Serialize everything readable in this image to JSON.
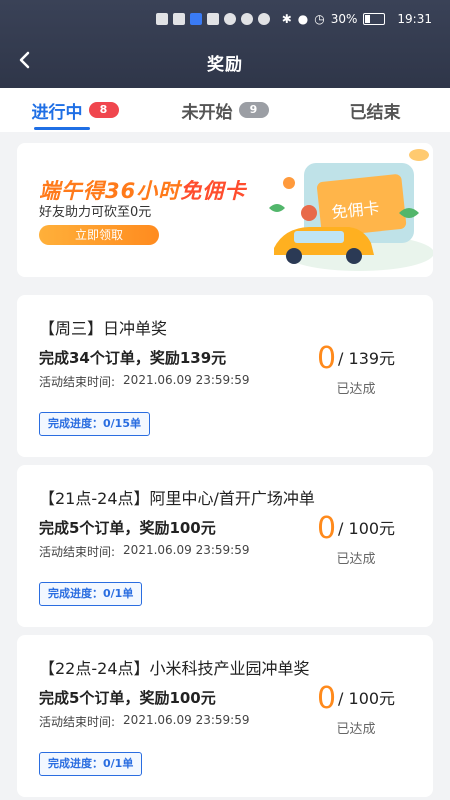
{
  "status_bar": {
    "battery": "30%",
    "time": "19:31"
  },
  "header": {
    "title": "奖励"
  },
  "tabs": [
    {
      "label": "进行中",
      "count": "8"
    },
    {
      "label": "未开始",
      "count": "9"
    },
    {
      "label": "已结束"
    }
  ],
  "banner": {
    "title_pre": "端午得36小时",
    "title_hl": "免佣卡",
    "subtitle": "好友助力可砍至0元",
    "button": "立即领取",
    "card_text": "免佣卡"
  },
  "cards": [
    {
      "title": "【周三】日冲单奖",
      "goal": "完成34个订单，奖励139元",
      "time_label": "活动结束时间:",
      "time_value": "2021.06.09 23:59:59",
      "progress": "完成进度：0/15单",
      "achieved": "0",
      "total": "/ 139元",
      "status": "已达成"
    },
    {
      "title": "【21点-24点】阿里中心/首开广场冲单",
      "goal": "完成5个订单，奖励100元",
      "time_label": "活动结束时间:",
      "time_value": "2021.06.09 23:59:59",
      "progress": "完成进度：0/1单",
      "achieved": "0",
      "total": "/ 100元",
      "status": "已达成"
    },
    {
      "title": "【22点-24点】小米科技产业园冲单奖",
      "goal": "完成5个订单，奖励100元",
      "time_label": "活动结束时间:",
      "time_value": "2021.06.09 23:59:59",
      "progress": "完成进度：0/1单",
      "achieved": "0",
      "total": "/ 100元",
      "status": "已达成"
    }
  ],
  "colors": {
    "accent": "#1f6fe5",
    "orange": "#ff8a1c",
    "header_bg": "#343b4f"
  }
}
